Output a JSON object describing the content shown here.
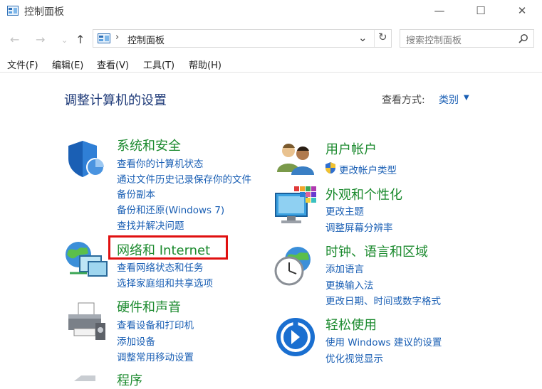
{
  "window": {
    "title": "控制面板",
    "minimize": "—",
    "maximize": "☐",
    "close": "✕"
  },
  "address": {
    "path": "控制面板",
    "sep": "›",
    "search_placeholder": "搜索控制面板"
  },
  "menu": [
    "文件(F)",
    "编辑(E)",
    "查看(V)",
    "工具(T)",
    "帮助(H)"
  ],
  "main": {
    "title": "调整计算机的设置",
    "view_label": "查看方式:",
    "view_value": "类别"
  },
  "categories": {
    "system": {
      "title": "系统和安全",
      "links": [
        "查看你的计算机状态",
        "通过文件历史记录保存你的文件",
        "备份副本",
        "备份和还原(Windows 7)",
        "查找并解决问题"
      ]
    },
    "network": {
      "title": "网络和 Internet",
      "links": [
        "查看网络状态和任务",
        "选择家庭组和共享选项"
      ]
    },
    "hardware": {
      "title": "硬件和声音",
      "links": [
        "查看设备和打印机",
        "添加设备",
        "调整常用移动设置"
      ]
    },
    "programs": {
      "title": "程序"
    },
    "users": {
      "title": "用户帐户",
      "links": [
        "更改帐户类型"
      ]
    },
    "appearance": {
      "title": "外观和个性化",
      "links": [
        "更改主题",
        "调整屏幕分辨率"
      ]
    },
    "clock": {
      "title": "时钟、语言和区域",
      "links": [
        "添加语言",
        "更换输入法",
        "更改日期、时间或数字格式"
      ]
    },
    "ease": {
      "title": "轻松使用",
      "links": [
        "使用 Windows 建议的设置",
        "优化视觉显示"
      ]
    }
  }
}
